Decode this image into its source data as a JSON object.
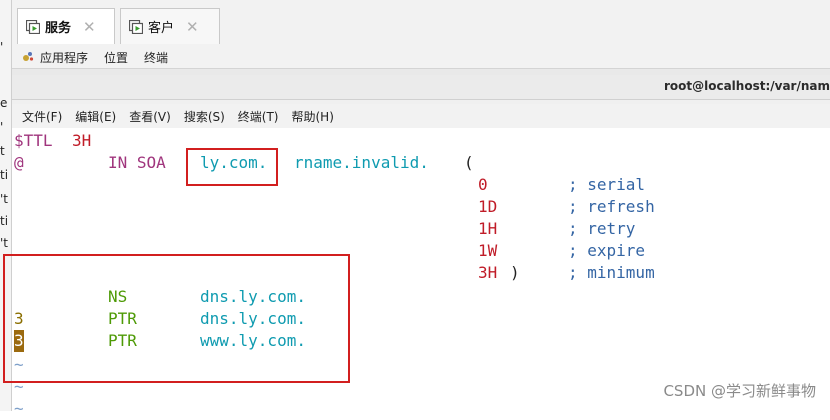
{
  "tabs": [
    {
      "label": "服务",
      "active": true
    },
    {
      "label": "客户",
      "active": false
    }
  ],
  "gnome_bar": {
    "applications": "应用程序",
    "places": "位置",
    "terminal": "终端"
  },
  "window": {
    "title": "root@localhost:/var/nam"
  },
  "menu": [
    "文件(F)",
    "编辑(E)",
    "查看(V)",
    "搜索(S)",
    "终端(T)",
    "帮助(H)"
  ],
  "edge_chars": [
    "'",
    "e",
    "'",
    "t",
    "ti",
    "'t",
    "ti",
    "'t"
  ],
  "editor": {
    "ttl_directive": "$TTL",
    "ttl_value": "3H",
    "origin": "@",
    "class_type": "IN SOA",
    "domain": "ly.com.",
    "rname": "rname.invalid.",
    "open_paren": "(",
    "soa_fields": [
      {
        "value": "0",
        "comment": "; serial"
      },
      {
        "value": "1D",
        "comment": "; refresh"
      },
      {
        "value": "1H",
        "comment": "; retry"
      },
      {
        "value": "1W",
        "comment": "; expire"
      },
      {
        "value": "3H",
        "close": ")",
        "comment": "; minimum"
      }
    ],
    "records": [
      {
        "name": "",
        "type": "NS",
        "target": "dns.ly.com."
      },
      {
        "name": "3",
        "type": "PTR",
        "target": "dns.ly.com."
      },
      {
        "name": "3",
        "type": "PTR",
        "target": "www.ly.com."
      }
    ],
    "tildes": [
      "~",
      "~",
      "~"
    ]
  },
  "watermark": "CSDN @学习新鲜事物",
  "colors": {
    "annotation": "#d21f1f",
    "keyword": "#a0357d",
    "number": "#c01c28",
    "rr_type": "#4e9a06",
    "domain": "#0f9bb0"
  }
}
